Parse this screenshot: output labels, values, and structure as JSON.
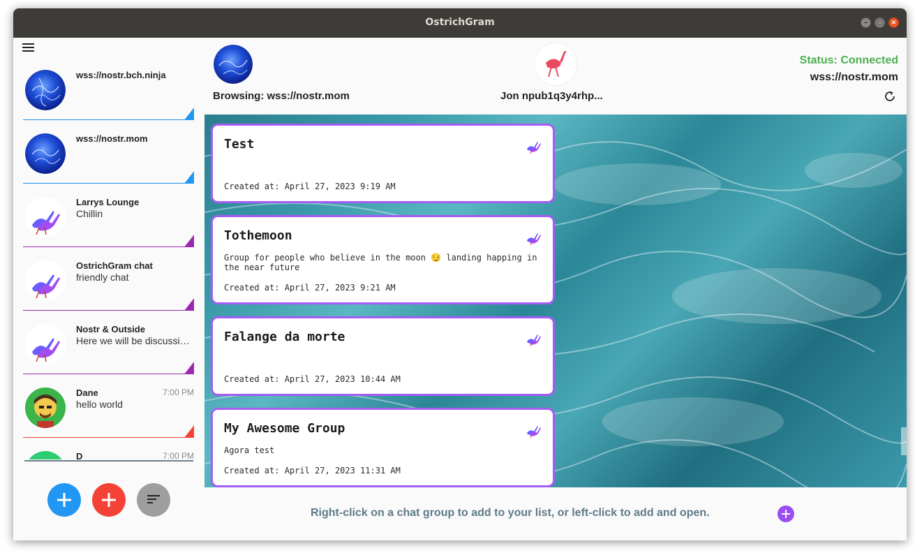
{
  "window": {
    "title": "OstrichGram",
    "controls": [
      "–",
      "□",
      "×"
    ]
  },
  "sidebar": {
    "rooms": [
      {
        "name": "wss://nostr.bch.ninja",
        "subtitle": "",
        "time": "",
        "avatar": "blue-orb",
        "accent": "#2196f3"
      },
      {
        "name": "wss://nostr.mom",
        "subtitle": "",
        "time": "",
        "avatar": "blue-orb",
        "accent": "#2196f3"
      },
      {
        "name": "Larrys Lounge",
        "subtitle": "Chillin",
        "time": "",
        "avatar": "ostrich-group",
        "accent": "#9c27b0"
      },
      {
        "name": "OstrichGram chat",
        "subtitle": "friendly chat",
        "time": "",
        "avatar": "ostrich-group",
        "accent": "#9c27b0"
      },
      {
        "name": "Nostr & Outside",
        "subtitle": "Here we will be discussing things about Nostr",
        "time": "",
        "avatar": "ostrich-group",
        "accent": "#9c27b0"
      },
      {
        "name": "Dane",
        "subtitle": "hello world",
        "time": "7:00 PM",
        "avatar": "person",
        "accent": "#f44336"
      },
      {
        "name": "D",
        "subtitle": "",
        "time": "7:00 PM",
        "avatar": "person-green",
        "accent": "#f44336"
      }
    ],
    "fabs": [
      {
        "name": "add-relay-button",
        "color": "#2196f3",
        "icon": "plus-icon"
      },
      {
        "name": "add-contact-button",
        "color": "#f44336",
        "icon": "plus-icon"
      },
      {
        "name": "sort-button",
        "color": "#9e9e9e",
        "icon": "sort-icon"
      }
    ]
  },
  "header": {
    "browsing": "Browsing: wss://nostr.mom",
    "user": "Jon  npub1q3y4rhp...",
    "status": "Status: Connected",
    "relay": "wss://nostr.mom",
    "status_color": "#4cae50"
  },
  "groups": [
    {
      "name": "Test",
      "description": "",
      "created": "Created at: April 27, 2023 9:19 AM"
    },
    {
      "name": "Tothemoon",
      "description": "Group for people who believe in the moon 😏 landing happing in the near future",
      "created": "Created at: April 27, 2023 9:21 AM"
    },
    {
      "name": "Falange da morte",
      "description": "",
      "created": "Created at: April 27, 2023 10:44 AM"
    },
    {
      "name": "My Awesome Group",
      "description": "Agora test",
      "created": "Created at: April 27, 2023 11:31 AM"
    }
  ],
  "footer": {
    "hint": "Right-click on a chat group to add to your list, or left-click to add and open.",
    "accent": "#9a4ef1"
  }
}
